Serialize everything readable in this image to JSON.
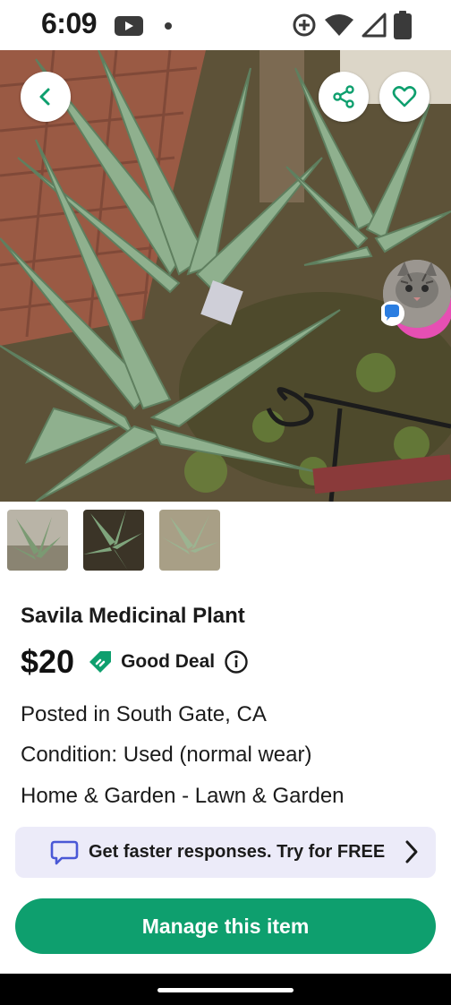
{
  "status_bar": {
    "time": "6:09",
    "icons": [
      "youtube-icon",
      "dot-icon",
      "data-saver-icon",
      "wifi-icon",
      "signal-icon",
      "battery-icon"
    ]
  },
  "hero": {
    "back_icon": "chevron-left-icon",
    "share_icon": "share-icon",
    "favorite_icon": "heart-icon",
    "chat_head_icon": "chat-bubble-icon"
  },
  "thumbnails": [
    {
      "name": "thumbnail-1",
      "selected": false
    },
    {
      "name": "thumbnail-2",
      "selected": true
    },
    {
      "name": "thumbnail-3",
      "selected": false
    }
  ],
  "listing": {
    "title": "Savila Medicinal Plant",
    "price": "$20",
    "deal_label": "Good Deal",
    "location": "Posted in South Gate, CA",
    "condition": "Condition: Used (normal wear)",
    "category": "Home & Garden - Lawn & Garden"
  },
  "promo": {
    "text": "Get faster responses. Try for FREE"
  },
  "actions": {
    "manage_label": "Manage this item"
  },
  "colors": {
    "accent_green": "#0e9f6e",
    "promo_bg": "#ecebf9",
    "promo_icon": "#4a58d6",
    "chat_pink": "#e64fb3"
  }
}
